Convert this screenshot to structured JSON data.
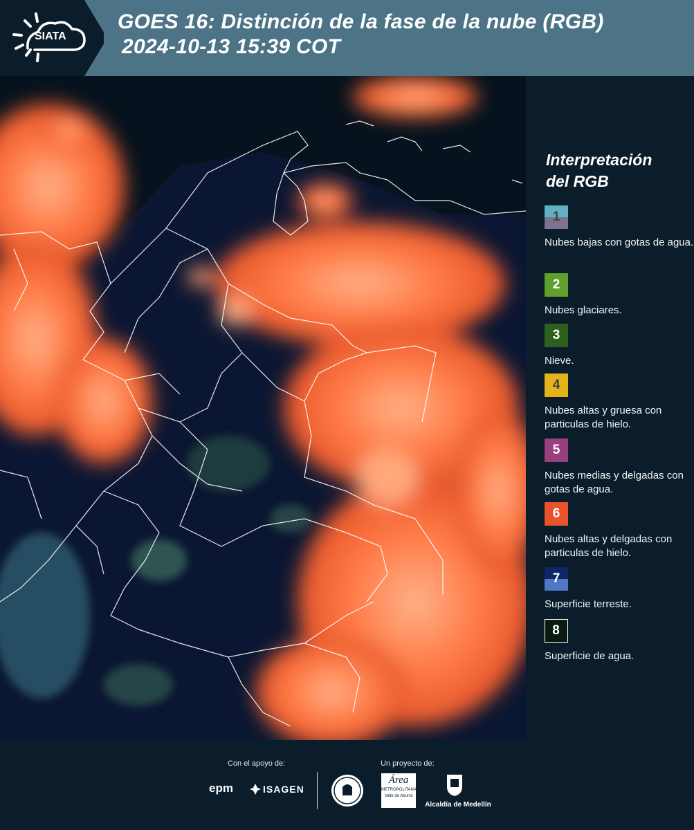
{
  "header": {
    "logo_text": "SIATA",
    "title_line1": "GOES 16: Distinción de la fase de la nube (RGB)",
    "title_line2": "2024-10-13 15:39 COT"
  },
  "legend": {
    "title_line1": "Interpretación",
    "title_line2": "del RGB",
    "items": [
      {
        "num": "1",
        "label": "Nubes bajas con gotas de agua.",
        "color_top": "#5fb1c3",
        "color_bottom": "#7d7390",
        "num_color": "#444444"
      },
      {
        "num": "2",
        "label": "Nubes glaciares.",
        "color": "#5fa02c",
        "num_color": "#ffffff"
      },
      {
        "num": "3",
        "label": "Nieve.",
        "color": "#2f5f1c",
        "num_color": "#ffffff"
      },
      {
        "num": "4",
        "label": "Nubes altas y gruesa con particulas de hielo.",
        "color": "#e4b31c",
        "num_color": "#444444"
      },
      {
        "num": "5",
        "label": "Nubes medias y delgadas con gotas de agua.",
        "color": "#9a3f7d",
        "num_color": "#ffffff"
      },
      {
        "num": "6",
        "label": "Nubes altas y delgadas con particulas de hielo.",
        "color": "#e9532a",
        "num_color": "#ffffff"
      },
      {
        "num": "7",
        "label": "Superficie terreste.",
        "color_top": "#102564",
        "color_bottom": "#4f77c3",
        "num_color": "#ffffff"
      },
      {
        "num": "8",
        "label": "Superficie de agua.",
        "color": "#0b1a10",
        "num_color": "#ffffff"
      }
    ]
  },
  "footer": {
    "support_label": "Con el apoyo de:",
    "project_label": "Un proyecto de:",
    "sponsor1": "epm",
    "sponsor2": "ISAGEN",
    "partner2_line1": "Área",
    "partner2_line2": "METROPOLITANA",
    "partner2_line3": "Valle de Aburrá",
    "partner3": "Alcaldía de Medellín"
  }
}
